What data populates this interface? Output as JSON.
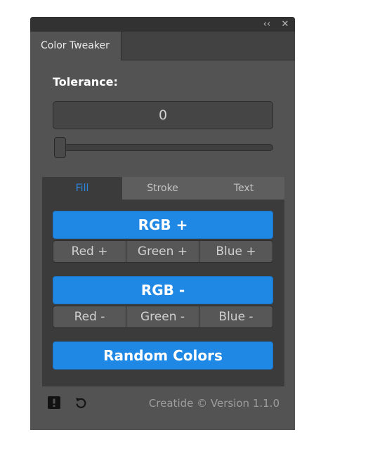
{
  "window": {
    "collapse_glyph": "‹‹",
    "close_glyph": "✕",
    "panel_tab": "Color Tweaker"
  },
  "tolerance": {
    "label": "Tolerance:",
    "value": "0",
    "slider_level": 0
  },
  "tabs": [
    {
      "label": "Fill",
      "active": true
    },
    {
      "label": "Stroke",
      "active": false
    },
    {
      "label": "Text",
      "active": false
    }
  ],
  "buttons": {
    "rgb_plus": "RGB +",
    "plus_row": [
      "Red +",
      "Green +",
      "Blue +"
    ],
    "rgb_minus": "RGB -",
    "minus_row": [
      "Red -",
      "Green -",
      "Blue -"
    ],
    "random": "Random Colors"
  },
  "footer": {
    "warning_icon": "exclamation-square-icon",
    "reset_icon": "undo-icon",
    "version_text": "Creatide © Version 1.1.0"
  },
  "colors": {
    "accent": "#1f88e5",
    "active_tab_text": "#2d86df",
    "panel_bg": "#535353"
  }
}
